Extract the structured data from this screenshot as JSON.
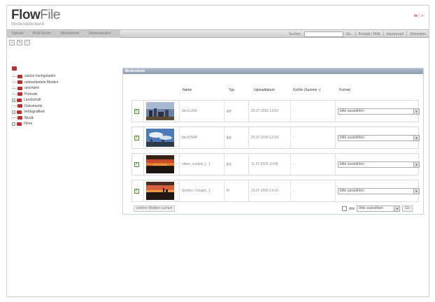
{
  "app": {
    "logo_bold": "Flow",
    "logo_light": "File",
    "subtitle": "Mediendatenbank"
  },
  "lang": {
    "active": "de",
    "sep": " | ",
    "other": "en"
  },
  "nav": {
    "tabs": [
      "Upload",
      "Profi-Suche",
      "Medienkorb",
      "Administration"
    ],
    "search_label": "Suchen",
    "search_value": "",
    "go_label": "Go",
    "links": [
      "Kontakt / Hilfe",
      "Impressum",
      "Abmelden"
    ]
  },
  "toolbar": {
    "icons": [
      "new-icon",
      "edit-icon",
      "view-icon"
    ]
  },
  "tree": {
    "items": [
      {
        "label": "zuletzt hochgeladen",
        "expander": ""
      },
      {
        "label": "unbearbeitete Medien",
        "expander": ""
      },
      {
        "label": "unsortiert",
        "expander": ""
      },
      {
        "label": "Portraits",
        "expander": ""
      },
      {
        "label": "Landschaft",
        "expander": "+"
      },
      {
        "label": "Dokumente",
        "expander": ""
      },
      {
        "label": "Veldugrafiken",
        "expander": "+"
      },
      {
        "label": "Musik",
        "expander": ""
      },
      {
        "label": "Filme",
        "expander": "+"
      }
    ]
  },
  "panel": {
    "title": "Medienkorb",
    "columns": {
      "name": "Name",
      "type": "Typ",
      "date": "Uploaddatum",
      "size": "Größe (Summe -)",
      "format": "Format"
    },
    "rows": [
      {
        "name": "dscn1280",
        "type": "jpg",
        "date": "25.07.2006 12:53",
        "size": "-",
        "format": "bitte auswählen",
        "checked": "✓",
        "thumb": "city-photo"
      },
      {
        "name": "dscn2544",
        "type": "jpg",
        "date": "25.07.2006 12:53",
        "size": "-",
        "format": "bitte auswählen",
        "checked": "✓",
        "thumb": "sky-photo"
      },
      {
        "name": "nikon_coolpix_[...]",
        "type": "jpg",
        "date": "11.07.2006 10:58",
        "size": "-",
        "format": "bitte auswählen",
        "checked": "✓",
        "thumb": "sunset-photo"
      },
      {
        "name": "Skyline Cologn[...]",
        "type": "tif",
        "date": "31.07.2006 14:10",
        "size": "-",
        "format": "bitte auswählen",
        "checked": "✓",
        "thumb": "skyline-photo"
      }
    ],
    "more_label": "weitere Medien suchen",
    "all_label": "Alle",
    "all_format": "bitte auswählen",
    "ok_label": "Go"
  },
  "colors": {
    "accent": "#c32a2a",
    "panel_header": "#9aabbc"
  }
}
